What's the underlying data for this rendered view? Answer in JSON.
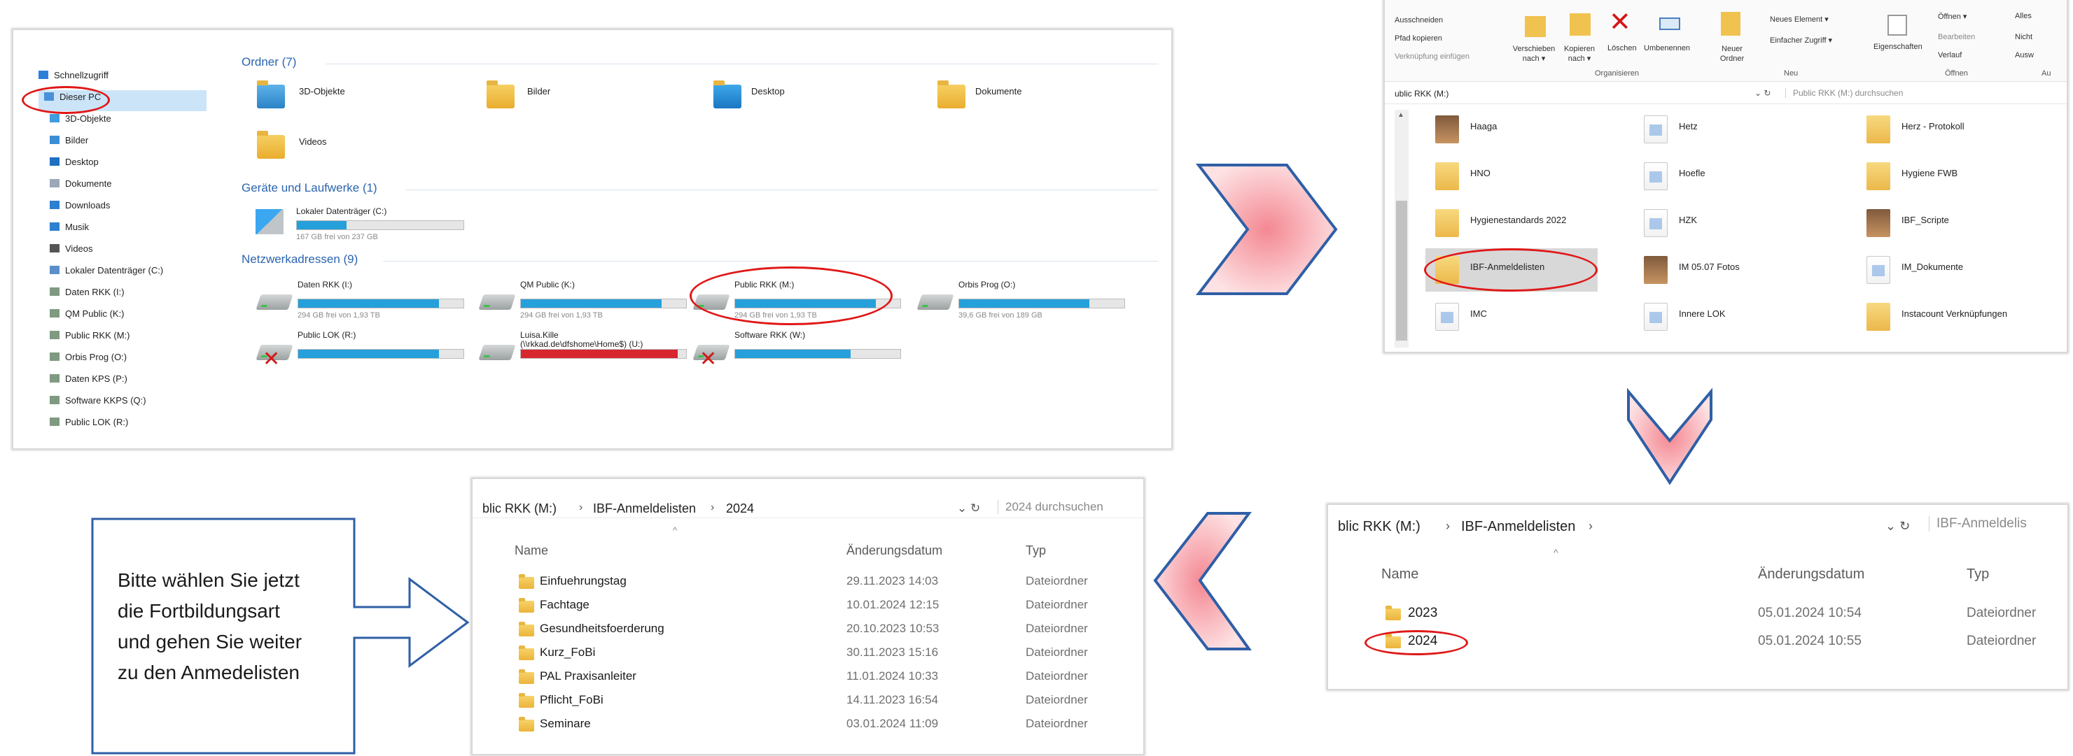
{
  "panel1": {
    "sidebar": [
      {
        "label": "Schnellzugriff",
        "icon": "star-icon"
      },
      {
        "label": "Dieser PC",
        "icon": "computer-icon"
      },
      {
        "label": "3D-Objekte",
        "icon": "cube-icon"
      },
      {
        "label": "Bilder",
        "icon": "pictures-icon"
      },
      {
        "label": "Desktop",
        "icon": "desktop-icon"
      },
      {
        "label": "Dokumente",
        "icon": "documents-icon"
      },
      {
        "label": "Downloads",
        "icon": "download-icon"
      },
      {
        "label": "Musik",
        "icon": "music-icon"
      },
      {
        "label": "Videos",
        "icon": "video-icon"
      },
      {
        "label": "Lokaler Datenträger (C:)",
        "icon": "disk-icon"
      },
      {
        "label": "Daten RKK (I:)",
        "icon": "network-drive-icon"
      },
      {
        "label": "QM Public (K:)",
        "icon": "network-drive-icon"
      },
      {
        "label": "Public RKK (M:)",
        "icon": "network-drive-icon"
      },
      {
        "label": "Orbis Prog (O:)",
        "icon": "network-drive-icon"
      },
      {
        "label": "Daten KPS (P:)",
        "icon": "network-drive-icon"
      },
      {
        "label": "Software KKPS (Q:)",
        "icon": "network-drive-icon"
      },
      {
        "label": "Public LOK (R:)",
        "icon": "network-drive-icon"
      }
    ],
    "sections": {
      "folders": "Ordner (7)",
      "devices": "Geräte und Laufwerke (1)",
      "network": "Netzwerkadressen (9)"
    },
    "folders": [
      "3D-Objekte",
      "Bilder",
      "Desktop",
      "Dokumente",
      "Videos"
    ],
    "local_drive": {
      "name": "Lokaler Datenträger (C:)",
      "free": "167 GB frei von 237 GB",
      "used": 0.3
    },
    "network_drives": [
      {
        "name": "Daten RKK (I:)",
        "free": "294 GB frei von 1,93 TB",
        "used": 0.85,
        "connected": true
      },
      {
        "name": "QM Public (K:)",
        "free": "294 GB frei von 1,93 TB",
        "used": 0.85,
        "connected": true
      },
      {
        "name": "Public RKK (M:)",
        "free": "294 GB frei von 1,93 TB",
        "used": 0.85,
        "connected": true
      },
      {
        "name": "Orbis Prog (O:)",
        "free": "39,6 GB frei von 189 GB",
        "used": 0.79,
        "connected": true
      },
      {
        "name": "Public LOK (R:)",
        "free": "",
        "used": 0.85,
        "connected": false
      },
      {
        "name": "Luisa.Kille\n(\\\\rkkad.de\\dfshome\\Home$) (U:)",
        "free": "",
        "used": 0.95,
        "connected": true
      },
      {
        "name": "Software RKK (W:)",
        "free": "",
        "used": 0.7,
        "connected": false
      }
    ]
  },
  "panel2": {
    "ribbon_left": [
      "Ausschneiden",
      "Pfad kopieren",
      "Verknüpfung einfügen"
    ],
    "ribbon_buttons": [
      "Verschieben nach ▾",
      "Kopieren nach ▾",
      "Löschen",
      "Umbenennen",
      "Neuer Ordner"
    ],
    "ribbon_new": [
      "Neues Element ▾",
      "Einfacher Zugriff ▾"
    ],
    "ribbon_props": "Eigenschaften",
    "ribbon_open": [
      "Öffnen ▾",
      "Bearbeiten",
      "Verlauf"
    ],
    "ribbon_select": [
      "Alles",
      "Nicht",
      "Ausw"
    ],
    "groups": [
      "Organisieren",
      "Neu",
      "Öffnen",
      "Au"
    ],
    "address": "ublic RKK (M:)",
    "search": "Public RKK (M:) durchsuchen",
    "items": [
      {
        "label": "Haaga",
        "kind": "img"
      },
      {
        "label": "Hetz",
        "kind": "doc"
      },
      {
        "label": "Herz - Protokoll",
        "kind": "folder"
      },
      {
        "label": "HNO",
        "kind": "folder"
      },
      {
        "label": "Hoefle",
        "kind": "doc"
      },
      {
        "label": "Hygiene FWB",
        "kind": "folder"
      },
      {
        "label": "Hygienestandards 2022",
        "kind": "folder"
      },
      {
        "label": "HZK",
        "kind": "doc"
      },
      {
        "label": "IBF_Scripte",
        "kind": "img"
      },
      {
        "label": "IBF-Anmeldelisten",
        "kind": "folder"
      },
      {
        "label": "IM 05.07 Fotos",
        "kind": "img"
      },
      {
        "label": "IM_Dokumente",
        "kind": "doc"
      },
      {
        "label": "IMC",
        "kind": "doc"
      },
      {
        "label": "Innere LOK",
        "kind": "doc"
      },
      {
        "label": "Instacount Verknüpfungen",
        "kind": "folder"
      }
    ]
  },
  "panel3": {
    "breadcrumb": [
      "blic RKK (M:)",
      "IBF-Anmeldelisten"
    ],
    "search": "IBF-Anmeldelis",
    "columns": [
      "Name",
      "Änderungsdatum",
      "Typ"
    ],
    "rows": [
      {
        "name": "2023",
        "date": "05.01.2024 10:54",
        "type": "Dateiordner"
      },
      {
        "name": "2024",
        "date": "05.01.2024 10:55",
        "type": "Dateiordner"
      }
    ]
  },
  "panel4": {
    "breadcrumb": [
      "blic RKK (M:)",
      "IBF-Anmeldelisten",
      "2024"
    ],
    "search": "2024 durchsuchen",
    "columns": [
      "Name",
      "Änderungsdatum",
      "Typ"
    ],
    "rows": [
      {
        "name": "Einfuehrungstag",
        "date": "29.11.2023 14:03",
        "type": "Dateiordner"
      },
      {
        "name": "Fachtage",
        "date": "10.01.2024 12:15",
        "type": "Dateiordner"
      },
      {
        "name": "Gesundheitsfoerderung",
        "date": "20.10.2023 10:53",
        "type": "Dateiordner"
      },
      {
        "name": "Kurz_FoBi",
        "date": "30.11.2023 15:16",
        "type": "Dateiordner"
      },
      {
        "name": "PAL Praxisanleiter",
        "date": "11.01.2024 10:33",
        "type": "Dateiordner"
      },
      {
        "name": "Pflicht_FoBi",
        "date": "14.11.2023 16:54",
        "type": "Dateiordner"
      },
      {
        "name": "Seminare",
        "date": "03.01.2024 11:09",
        "type": "Dateiordner"
      }
    ]
  },
  "callout": {
    "lines": [
      "Bitte wählen Sie jetzt",
      "die Fortbildungsart",
      "und gehen Sie weiter",
      "zu den Anmedelisten"
    ]
  },
  "colors": {
    "accent": "#26a0da",
    "highlight_oval": "#e01818",
    "arrow_stroke": "#2f5fa6",
    "arrow_fill": "#f6a0a8",
    "callout_stroke": "#2f5fa6"
  }
}
